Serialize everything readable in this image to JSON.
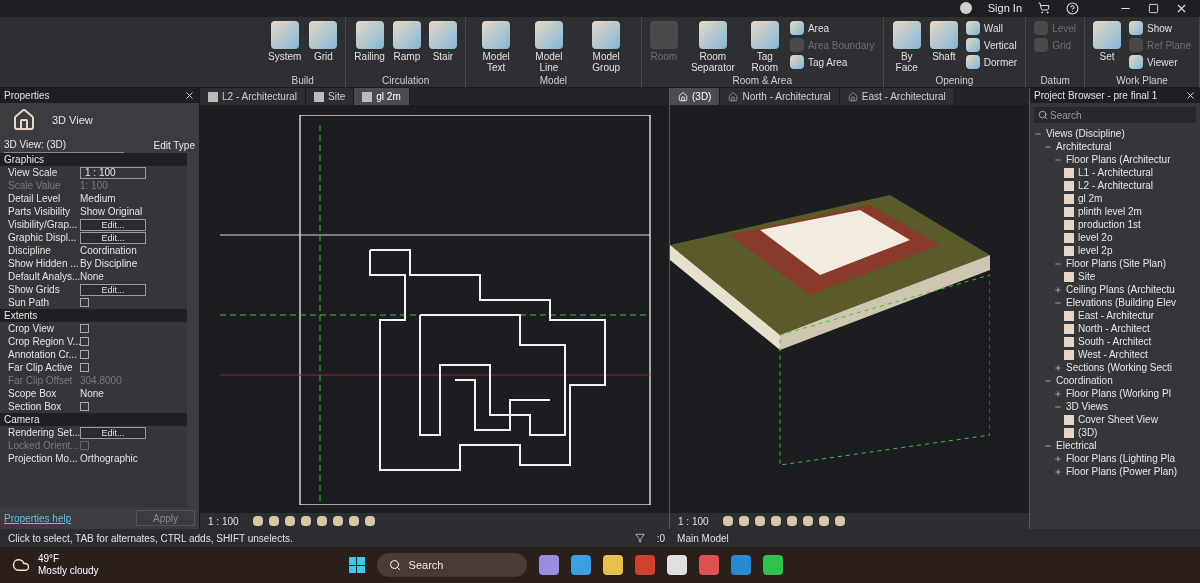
{
  "ribbon": {
    "user": {
      "label": "Sign In"
    },
    "panels": [
      {
        "title": "Build",
        "large": [
          {
            "label": "System",
            "disabled": false
          },
          {
            "label": "Grid",
            "disabled": false
          }
        ]
      },
      {
        "title": "Circulation",
        "large": [
          {
            "label": "Railing",
            "disabled": false
          },
          {
            "label": "Ramp",
            "disabled": false
          },
          {
            "label": "Stair",
            "disabled": false
          }
        ]
      },
      {
        "title": "Model",
        "large": [
          {
            "label": "Model Text",
            "disabled": false
          },
          {
            "label": "Model Line",
            "disabled": false
          },
          {
            "label": "Model Group",
            "disabled": false
          }
        ]
      },
      {
        "title": "Room & Area",
        "large": [
          {
            "label": "Room",
            "disabled": true
          },
          {
            "label": "Room Separator",
            "disabled": false
          },
          {
            "label": "Tag Room",
            "disabled": false
          }
        ],
        "small": [
          {
            "label": "Area",
            "disabled": false
          },
          {
            "label": "Area Boundary",
            "disabled": true
          },
          {
            "label": "Tag Area",
            "disabled": false
          }
        ]
      },
      {
        "title": "Opening",
        "large": [
          {
            "label": "By Face",
            "disabled": false
          },
          {
            "label": "Shaft",
            "disabled": false
          }
        ],
        "small": [
          {
            "label": "Wall",
            "disabled": false
          },
          {
            "label": "Vertical",
            "disabled": false
          },
          {
            "label": "Dormer",
            "disabled": false
          }
        ]
      },
      {
        "title": "Datum",
        "small": [
          {
            "label": "Level",
            "disabled": true
          },
          {
            "label": "Grid",
            "disabled": true
          }
        ]
      },
      {
        "title": "Work Plane",
        "large": [
          {
            "label": "Set",
            "disabled": false
          }
        ],
        "small": [
          {
            "label": "Show",
            "disabled": false
          },
          {
            "label": "Ref Plane",
            "disabled": true
          },
          {
            "label": "Viewer",
            "disabled": false
          }
        ]
      }
    ]
  },
  "properties": {
    "title": "Properties",
    "type": "3D View",
    "selector": "3D View: (3D)",
    "edit_type": "Edit Type",
    "sections": [
      {
        "title": "Graphics",
        "rows": [
          {
            "label": "View Scale",
            "kind": "field",
            "value": "1 : 100",
            "disabled": false
          },
          {
            "label": "Scale Value",
            "kind": "value",
            "value": "1: 100",
            "disabled": true
          },
          {
            "label": "Detail Level",
            "kind": "value",
            "value": "Medium",
            "disabled": false
          },
          {
            "label": "Parts Visibility",
            "kind": "value",
            "value": "Show Original",
            "disabled": false
          },
          {
            "label": "Visibility/Grap...",
            "kind": "button",
            "value": "Edit...",
            "disabled": false
          },
          {
            "label": "Graphic Displ...",
            "kind": "button",
            "value": "Edit...",
            "disabled": false
          },
          {
            "label": "Discipline",
            "kind": "value",
            "value": "Coordination",
            "disabled": false
          },
          {
            "label": "Show Hidden ...",
            "kind": "value",
            "value": "By Discipline",
            "disabled": false
          },
          {
            "label": "Default Analys...",
            "kind": "value",
            "value": "None",
            "disabled": false
          },
          {
            "label": "Show Grids",
            "kind": "button",
            "value": "Edit...",
            "disabled": false
          },
          {
            "label": "Sun Path",
            "kind": "checkbox",
            "checked": false,
            "disabled": false
          }
        ]
      },
      {
        "title": "Extents",
        "rows": [
          {
            "label": "Crop View",
            "kind": "checkbox",
            "checked": false,
            "disabled": false
          },
          {
            "label": "Crop Region V...",
            "kind": "checkbox",
            "checked": false,
            "disabled": false
          },
          {
            "label": "Annotation Cr...",
            "kind": "checkbox",
            "checked": false,
            "disabled": false
          },
          {
            "label": "Far Clip Active",
            "kind": "checkbox",
            "checked": false,
            "disabled": false
          },
          {
            "label": "Far Clip Offset",
            "kind": "value",
            "value": "304.8000",
            "disabled": true
          },
          {
            "label": "Scope Box",
            "kind": "value",
            "value": "None",
            "disabled": false
          },
          {
            "label": "Section Box",
            "kind": "checkbox",
            "checked": false,
            "disabled": false
          }
        ]
      },
      {
        "title": "Camera",
        "rows": [
          {
            "label": "Rendering Set...",
            "kind": "button",
            "value": "Edit...",
            "disabled": false
          },
          {
            "label": "Locked Orient...",
            "kind": "checkbox",
            "checked": false,
            "disabled": true
          },
          {
            "label": "Projection Mo...",
            "kind": "value",
            "value": "Orthographic",
            "disabled": false
          }
        ]
      }
    ],
    "help": "Properties help",
    "apply": "Apply"
  },
  "plan_view": {
    "tabs": [
      {
        "label": "L2 - Architectural",
        "selected": false
      },
      {
        "label": "Site",
        "selected": false
      },
      {
        "label": "gl 2m",
        "selected": true
      }
    ],
    "scale": "1 : 100"
  },
  "model_view": {
    "tabs": [
      {
        "label": "(3D)",
        "selected": true,
        "kind": "home"
      },
      {
        "label": "North - Architectural",
        "selected": false,
        "kind": "elevation"
      },
      {
        "label": "East - Architectural",
        "selected": false,
        "kind": "elevation"
      }
    ],
    "scale": "1 : 100"
  },
  "project_browser": {
    "title": "Project Browser - pre final 1",
    "search": {
      "placeholder": "Search"
    },
    "tree": [
      {
        "label": "Views (Discipline)",
        "expanded": true,
        "children": [
          {
            "label": "Architectural",
            "expanded": true,
            "children": [
              {
                "label": "Floor Plans (Architectur",
                "expanded": true,
                "children": [
                  {
                    "label": "L1 - Architectural"
                  },
                  {
                    "label": "L2 - Architectural"
                  },
                  {
                    "label": "gl 2m"
                  },
                  {
                    "label": "plinth level 2m"
                  },
                  {
                    "label": "production 1st"
                  },
                  {
                    "label": "level 2o"
                  },
                  {
                    "label": "level 2p"
                  }
                ]
              },
              {
                "label": "Floor Plans (Site Plan)",
                "expanded": true,
                "children": [
                  {
                    "label": "Site"
                  }
                ]
              },
              {
                "label": "Ceiling Plans (Architectu",
                "expanded": false
              },
              {
                "label": "Elevations (Building Elev",
                "expanded": true,
                "children": [
                  {
                    "label": "East - Architectur"
                  },
                  {
                    "label": "North - Architect"
                  },
                  {
                    "label": "South - Architect"
                  },
                  {
                    "label": "West - Architect"
                  }
                ]
              },
              {
                "label": "Sections (Working Secti",
                "expanded": false
              }
            ]
          },
          {
            "label": "Coordination",
            "expanded": true,
            "children": [
              {
                "label": "Floor Plans (Working Pl",
                "expanded": false
              },
              {
                "label": "3D Views",
                "expanded": true,
                "children": [
                  {
                    "label": "Cover Sheet View"
                  },
                  {
                    "label": "(3D)"
                  }
                ]
              }
            ]
          },
          {
            "label": "Electrical",
            "expanded": true,
            "children": [
              {
                "label": "Floor Plans (Lighting Pla",
                "expanded": false
              },
              {
                "label": "Floor Plans (Power Plan)",
                "expanded": false
              }
            ]
          }
        ]
      }
    ]
  },
  "status_bar": {
    "message": "Click to select, TAB for alternates, CTRL adds, SHIFT unselects.",
    "selection_count": ":0",
    "workset": "Main Model"
  },
  "taskbar": {
    "weather": {
      "temperature": "49°F",
      "condition": "Mostly cloudy"
    },
    "search": {
      "placeholder": "Search"
    }
  }
}
